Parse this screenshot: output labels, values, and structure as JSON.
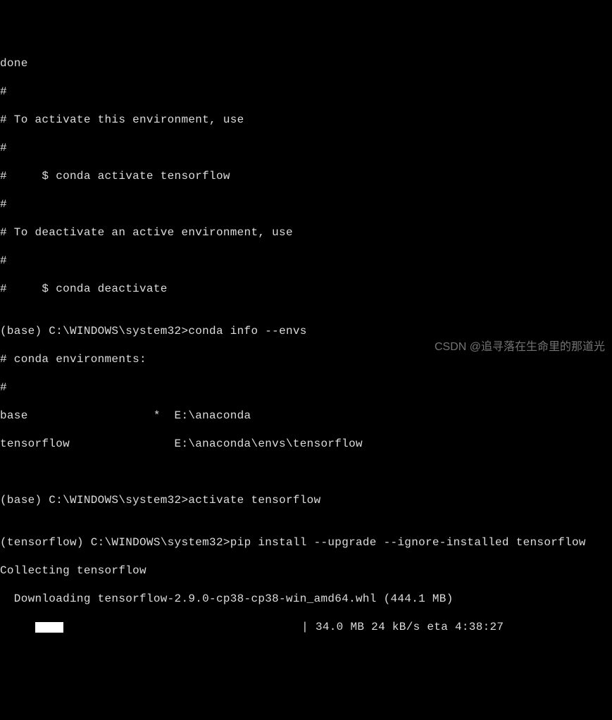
{
  "lines": {
    "l0": "done",
    "l1": "#",
    "l2": "# To activate this environment, use",
    "l3": "#",
    "l4": "#     $ conda activate tensorflow",
    "l5": "#",
    "l6": "# To deactivate an active environment, use",
    "l7": "#",
    "l8": "#     $ conda deactivate",
    "l9": "",
    "prompt1_prefix": "(base) C:\\WINDOWS\\system32>",
    "prompt1_cmd": "conda info --envs",
    "envs_header": "# conda environments:",
    "envs_hash": "#",
    "env_row1": "base                  *  E:\\anaconda",
    "env_row2": "tensorflow               E:\\anaconda\\envs\\tensorflow",
    "blank": "",
    "prompt2_prefix": "(base) C:\\WINDOWS\\system32>",
    "prompt2_cmd": "activate tensorflow",
    "prompt3_prefix": "(tensorflow) C:\\WINDOWS\\system32>",
    "prompt3_cmd": "pip install --upgrade --ignore-installed tensorflow",
    "collecting": "Collecting tensorflow",
    "downloading": "  Downloading tensorflow-2.9.0-cp38-cp38-win_amd64.whl (444.1 MB)",
    "progress_leading": "     ",
    "progress_trailing": "                                  | 34.0 MB 24 kB/s eta 4:38:27"
  },
  "watermark": "CSDN @追寻落在生命里的那道光"
}
